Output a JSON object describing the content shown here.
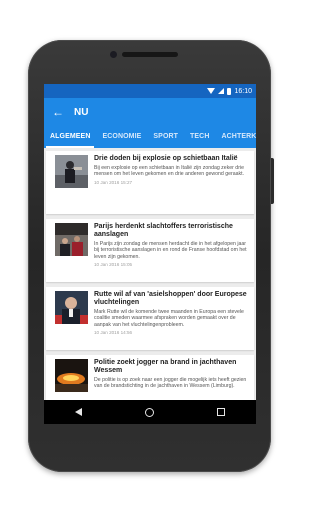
{
  "status_bar": {
    "time": "16:10"
  },
  "app_bar": {
    "title": "NU"
  },
  "tabs": [
    {
      "label": "ALGEMEEN",
      "active": true
    },
    {
      "label": "ECONOMIE",
      "active": false
    },
    {
      "label": "SPORT",
      "active": false
    },
    {
      "label": "TECH",
      "active": false
    },
    {
      "label": "ACHTERKLAP",
      "active": false
    }
  ],
  "articles": [
    {
      "headline": "Drie doden bij explosie op schietbaan Italië",
      "excerpt": "Bij een explosie op een schietbaan in Italië zijn zondag zeker drie mensen om het leven gekomen en drie anderen gewond geraakt.",
      "date": "10 Jan 2016 15:27"
    },
    {
      "headline": "Parijs herdenkt slachtoffers terroristische aanslagen",
      "excerpt": "In Parijs zijn zondag de mensen herdacht die in het afgelopen jaar bij terroristische aanslagen in en rond de Franse hoofdstad om het leven zijn gekomen.",
      "date": "10 Jan 2016 15:05"
    },
    {
      "headline": "Rutte wil af van 'asielshoppen' door Europese vluchtelingen",
      "excerpt": "Mark Rutte wil de komende twee maanden in Europa een stevele coalitie smeden waarmee afspraken worden gemaakt over de aanpak van het vluchtelingenprobleem.",
      "date": "10 Jan 2016 14:56"
    },
    {
      "headline": "Politie zoekt jogger na brand in jachthaven Wessem",
      "excerpt": "De politie is op zoek naar een jogger die mogelijk iets heeft gezien van de brandstichting in de jachthaven in Wessem (Limburg).",
      "date": ""
    }
  ],
  "icons": {
    "back": "arrow-left-icon",
    "nav_back": "triangle-back-icon",
    "nav_home": "circle-home-icon",
    "nav_recent": "square-recent-icon"
  },
  "colors": {
    "primary": "#1e88e5",
    "status_bar": "#1565c0"
  }
}
